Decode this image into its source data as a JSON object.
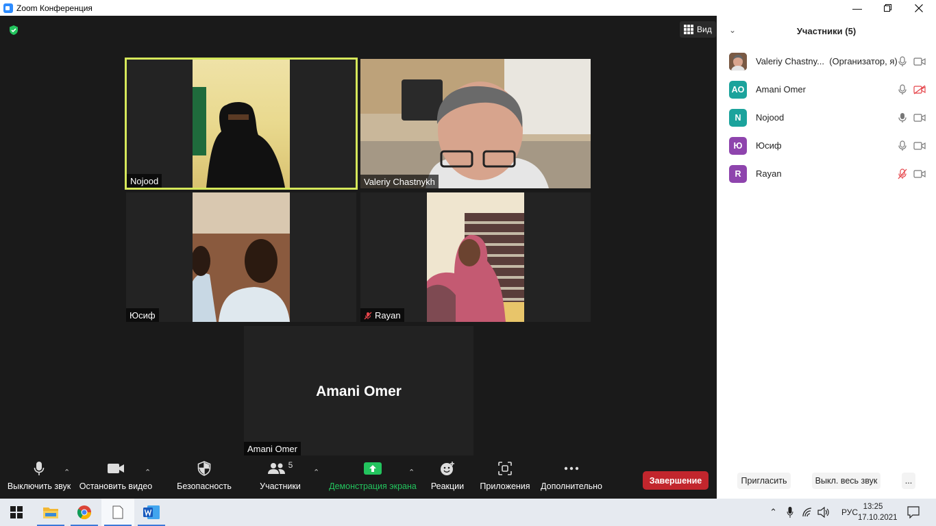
{
  "window": {
    "title": "Zoom Конференция"
  },
  "main": {
    "view_label": "Вид",
    "tiles": {
      "nojood": "Nojood",
      "valeriy": "Valeriy Chastnykh",
      "yusif": "Юсиф",
      "rayan": "Rayan",
      "amani": "Amani Omer",
      "amani_big": "Amani Omer"
    }
  },
  "toolbar": {
    "mute": "Выключить звук",
    "video": "Остановить видео",
    "security": "Безопасность",
    "participants": "Участники",
    "participants_count": "5",
    "share": "Демонстрация экрана",
    "reactions": "Реакции",
    "apps": "Приложения",
    "more": "Дополнительно",
    "end": "Завершение"
  },
  "panel": {
    "title": "Участники (5)",
    "participants": [
      {
        "name": "Valeriy Chastny...",
        "role": "(Организатор, я)",
        "avatar": "",
        "mic": "on",
        "cam": "on"
      },
      {
        "name": "Amani Omer",
        "role": "",
        "avatar": "AO",
        "color": "#1ba39c",
        "mic": "on",
        "cam": "off"
      },
      {
        "name": "Nojood",
        "role": "",
        "avatar": "N",
        "color": "#1ba39c",
        "mic": "on",
        "cam": "on"
      },
      {
        "name": "Юсиф",
        "role": "",
        "avatar": "Ю",
        "color": "#8e44ad",
        "mic": "on",
        "cam": "on"
      },
      {
        "name": "Rayan",
        "role": "",
        "avatar": "R",
        "color": "#8e44ad",
        "mic": "off",
        "cam": "on"
      }
    ],
    "invite": "Пригласить",
    "mute_all": "Выкл. весь звук",
    "more": "..."
  },
  "taskbar": {
    "language": "РУС",
    "time": "13:25",
    "date": "17.10.2021"
  }
}
